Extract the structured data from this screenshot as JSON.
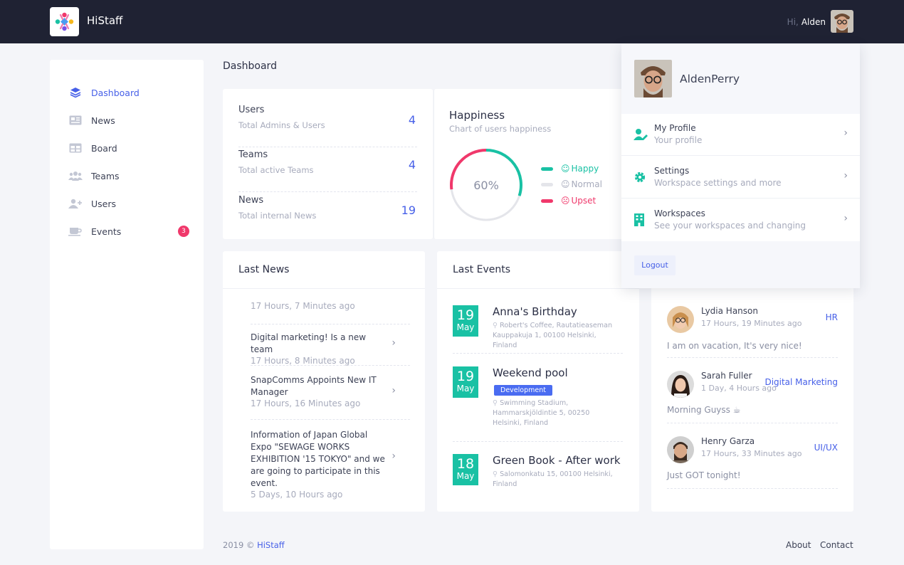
{
  "app": {
    "brand": "HiStaff"
  },
  "header": {
    "greeting": "Hi,",
    "user_short": "Alden"
  },
  "sidebar": {
    "items": [
      {
        "label": "Dashboard",
        "icon": "layers-icon"
      },
      {
        "label": "News",
        "icon": "newspaper-icon"
      },
      {
        "label": "Board",
        "icon": "board-icon"
      },
      {
        "label": "Teams",
        "icon": "teams-icon"
      },
      {
        "label": "Users",
        "icon": "add-user-icon"
      },
      {
        "label": "Events",
        "icon": "coffee-icon",
        "badge": "3"
      }
    ]
  },
  "page_title": "Dashboard",
  "stats": [
    {
      "title": "Users",
      "subtitle": "Total Admins & Users",
      "value": "4"
    },
    {
      "title": "Teams",
      "subtitle": "Total active Teams",
      "value": "4"
    },
    {
      "title": "News",
      "subtitle": "Total internal News",
      "value": "19"
    }
  ],
  "happiness": {
    "title": "Happiness",
    "subtitle": "Chart of users happiness",
    "center_label": "60%",
    "legend": [
      {
        "label": "Happy",
        "color": "#19c1a4"
      },
      {
        "label": "Normal",
        "color": "#e4e5ea"
      },
      {
        "label": "Upset",
        "color": "#f0386b"
      }
    ],
    "chart_data": {
      "type": "pie",
      "categories": [
        "Happy",
        "Normal",
        "Upset"
      ],
      "values": [
        60,
        22,
        18
      ]
    }
  },
  "last_news": {
    "title": "Last News",
    "items": [
      {
        "text": "",
        "time": "17 Hours, 7 Minutes ago"
      },
      {
        "text": "Digital marketing! Is a new team",
        "time": "17 Hours, 8 Minutes ago"
      },
      {
        "text": "SnapComms Appoints New IT Manager",
        "time": "17 Hours, 16 Minutes ago"
      },
      {
        "text": "Information of Japan Global Expo \"SEWAGE WORKS EXHIBITION '15 TOKYO\" and we are going to participate in this event.",
        "time": "5 Days, 10 Hours ago"
      }
    ]
  },
  "last_events": {
    "title": "Last Events",
    "items": [
      {
        "day": "19",
        "month": "May",
        "title": "Anna's Birthday",
        "tag": "",
        "location": "Robert's Coffee, Rautatieaseman Kauppakuja 1, 00100 Helsinki, Finland"
      },
      {
        "day": "19",
        "month": "May",
        "title": "Weekend pool",
        "tag": "Development",
        "location": "Swimming Stadium, Hammarskjöldintie 5, 00250 Helsinki, Finland"
      },
      {
        "day": "18",
        "month": "May",
        "title": "Green Book - After work",
        "tag": "",
        "location": "Salomonkatu 15, 00100 Helsinki, Finland"
      }
    ]
  },
  "people": [
    {
      "name": "Lydia Hanson",
      "time": "17 Hours, 19 Minutes ago",
      "dept": "HR",
      "message": "I am on vacation, It's very nice!"
    },
    {
      "name": "Sarah Fuller",
      "time": "1 Day, 4 Hours ago",
      "dept": "Digital Marketing",
      "message": "Morning Guyss ☕"
    },
    {
      "name": "Henry Garza",
      "time": "17 Hours, 33 Minutes ago",
      "dept": "UI/UX",
      "message": "Just GOT tonight!"
    }
  ],
  "profile_menu": {
    "name": "AldenPerry",
    "items": [
      {
        "title": "My Profile",
        "subtitle": "Your profile",
        "icon": "user-edit-icon"
      },
      {
        "title": "Settings",
        "subtitle": "Workspace settings and more",
        "icon": "gear-icon"
      },
      {
        "title": "Workspaces",
        "subtitle": "See your workspaces and changing",
        "icon": "building-icon"
      }
    ],
    "logout": "Logout"
  },
  "footer": {
    "year": "2019",
    "copyright_symbol": "©",
    "brand": "HiStaff",
    "links": [
      "About",
      "Contact"
    ]
  },
  "colors": {
    "accent": "#4760e8",
    "teal": "#19c1a4",
    "pink": "#f0386b",
    "topbar": "#1f2233"
  }
}
